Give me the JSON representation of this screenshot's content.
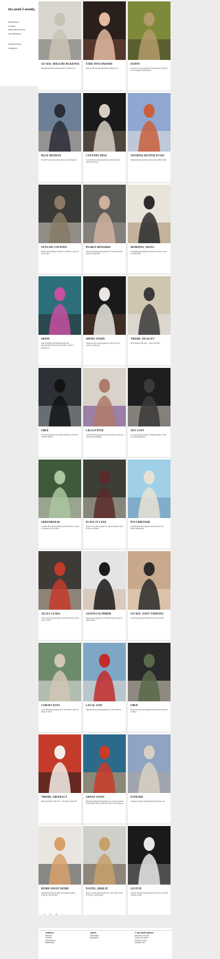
{
  "brand": "the week // weekly",
  "nav": [
    "Work/About",
    "Contact",
    "Work Recent work",
    "Journal/Notes",
    "Studio Archive",
    "Instagram"
  ],
  "cards": [
    {
      "title": "GO SEE: MEGUMI MCKENNA",
      "desc": "Megumi McKenna photographed by Henry Lee"
    },
    {
      "title": "FADE INTO BWANSE",
      "desc": "Stills by Bwanse photographed by Henry Lee"
    },
    {
      "title": "DANNY",
      "desc": "Evie & Cory photographed by Madeleine, styled by Jacob Driggs & Anne Mayer"
    },
    {
      "title": "BLUE MONDAY",
      "desc": "Eyal & Tosia photographed by Lottie Christopher"
    },
    {
      "title": "COUNTRY MILE",
      "desc": "Cole Thomson photographed by Oliver Daniels, styled by Ria Kay"
    },
    {
      "title": "NOTHING BETTER TO DO",
      "desc": "Kingdom photographed and styled by Rhys Owen"
    },
    {
      "title": "OUTLAW COUNTRY",
      "desc": "Martha photographed by Rebecca Shubert, styled by Shawn Kuo"
    },
    {
      "title": "PEARLY REWARDS",
      "desc": "Kate Kozjanicki photographed by Vincent Delgado, styled by Anne Bell"
    },
    {
      "title": "MORNING, SEOUL",
      "desc": "Seungmin photographed by Kamil Lusardo, styled by Gilber Hira"
    },
    {
      "title": "IRONS",
      "desc": "Marita Phillips and Malaiqui Naberash photographed by Francesko Dagnit, styled by Dell'ak Loti"
    },
    {
      "title": "SHORT STORY",
      "desc": "Shauna & Tesla photographed by Jane de Lima, styled by Angie Liu"
    },
    {
      "title": "THEME: DUALITY",
      "desc": "Print themes 19th 2021 – April 11th 2021"
    },
    {
      "title": "EBEN",
      "desc": "Eben photographed by Thomas Summers, styled by Camille Dufont"
    },
    {
      "title": "LILJA ETTER",
      "desc": "Lilja Etter photographed by Petra Mikoski, styled by Alexander del Miguel"
    },
    {
      "title": "GET LOST",
      "desc": "Ko Canon photographed by Dmitri Mitago, styled by Andrea Bukozuto"
    },
    {
      "title": "GREENHOUSE",
      "desc": "Carmen rubes photographed by Marissa Frost, styled by Susanna de los Santos"
    },
    {
      "title": "PLAYS IT COOL",
      "desc": "Martin Scott photographed by Olga Chandler, styled by Peters Schultze"
    },
    {
      "title": "PULCHRITUDE",
      "desc": "Richard Rhie photographed and styled by Lisa Marie Hardenberg"
    },
    {
      "title": "ALLES CLARA",
      "desc": "Clara Stauss photographed by Robin Maiochi, styled by Iris Grubb"
    },
    {
      "title": "ALWAYS GLIMMER",
      "desc": "Mariko photographed by Jennifer Dawn, beauty by Amelia Bern"
    },
    {
      "title": "GO SEE: ZOEY TARPONG",
      "desc": "Zoey photographed in Berlin by Jovana Petrik"
    },
    {
      "title": "CORSET DAYS",
      "desc": "Ceri Peneda photographed by Villa Basala, styled by Shaya Coucher"
    },
    {
      "title": "LOCAL GOD",
      "desc": "Nnamdi Okonta photographed by Connor Helton"
    },
    {
      "title": "EBEN",
      "desc": "Eben Lettorme photographed by Anastasia & Sasha Lambert"
    },
    {
      "title": "THEME: ABSTRACT",
      "desc": "Print September 20th 2021 – December 10th 2021"
    },
    {
      "title": "GHOST TOWN",
      "desc": "Merna Rosenthal photographed by Conner & Adrian & Alexander Rivera, styled by Tierra Cruz Ashgrove"
    },
    {
      "title": "ESTRADE",
      "desc": "Segonix Polanger photographed by Marina Lees"
    },
    {
      "title": "HOME SWEET HOME",
      "desc": "Pauline Billy photographed by Raphael Rognes, styled by Chris Dozier"
    },
    {
      "title": "PASTEL, BERLIN",
      "desc": "Nancy Cotonin photographed by Leila Thue, styled by Steven a Applebaum"
    },
    {
      "title": "GLITCH",
      "desc": "Nevanne Ria photographed by Ria Sorrow, styled by Gudrun Loehne"
    }
  ],
  "pager": [
    "1",
    "2",
    "3",
    "→"
  ],
  "footer": {
    "col1_head": "CONTACT",
    "col1": [
      "Editorial",
      "Contact",
      "Submissions",
      "Mastheads"
    ],
    "col2_head": "ABOUT",
    "col2": [
      "Information",
      "Newsletter"
    ],
    "col3_head": "© THE WEEK WEEKLY",
    "col3": [
      "All rights reserved",
      "Privacy & imprint",
      "Privacy & terms",
      "Contact mail"
    ]
  }
}
